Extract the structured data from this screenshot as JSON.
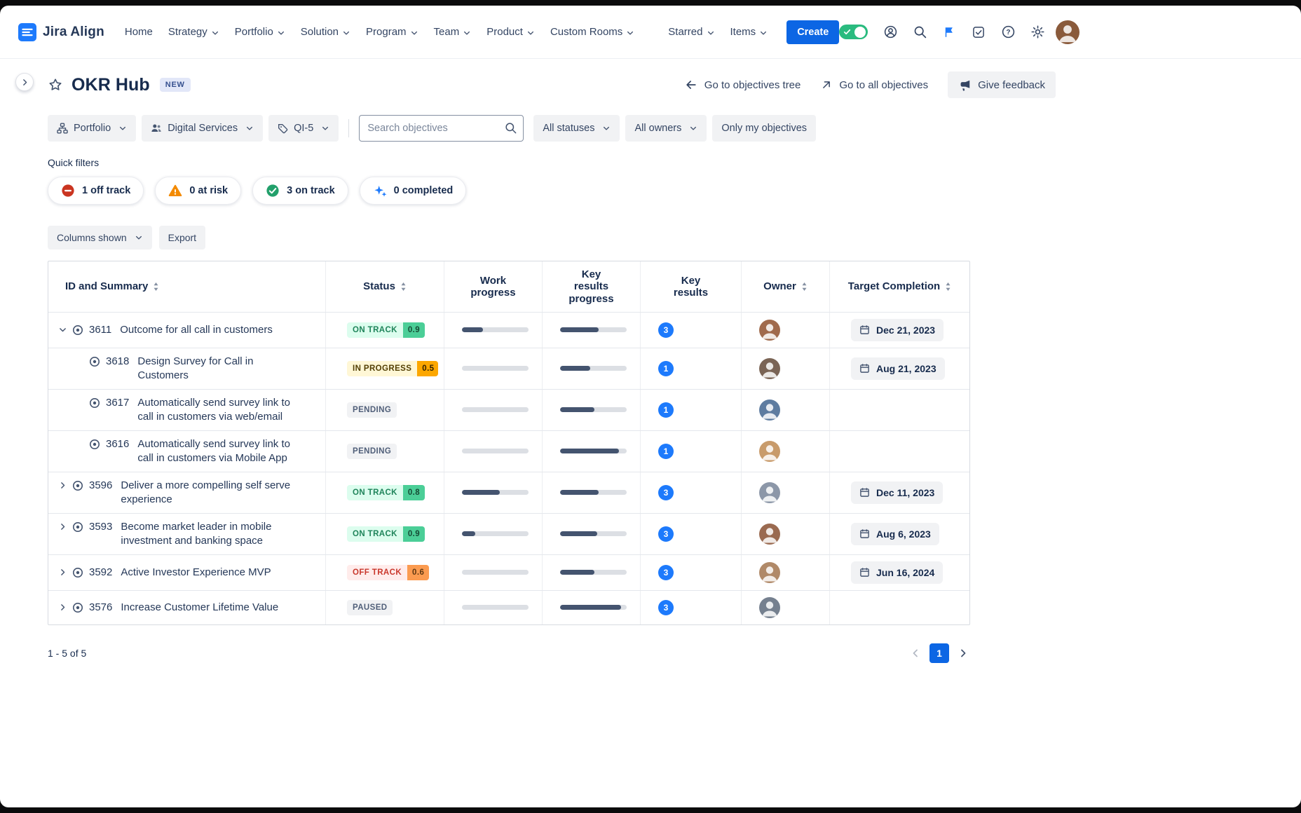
{
  "nav": {
    "brand": "Jira Align",
    "items": [
      {
        "label": "Home",
        "dropdown": false
      },
      {
        "label": "Strategy",
        "dropdown": true
      },
      {
        "label": "Portfolio",
        "dropdown": true
      },
      {
        "label": "Solution",
        "dropdown": true
      },
      {
        "label": "Program",
        "dropdown": true
      },
      {
        "label": "Team",
        "dropdown": true
      },
      {
        "label": "Product",
        "dropdown": true
      },
      {
        "label": "Custom Rooms",
        "dropdown": true
      },
      {
        "label": "Starred",
        "dropdown": true
      },
      {
        "label": "Items",
        "dropdown": true
      }
    ],
    "create_label": "Create"
  },
  "header": {
    "title": "OKR Hub",
    "badge": "NEW",
    "tree_link": "Go to objectives tree",
    "all_objectives_link": "Go to all objectives",
    "feedback_button": "Give feedback"
  },
  "filters": {
    "portfolio": "Portfolio",
    "program": "Digital Services",
    "interval": "QI-5",
    "search_placeholder": "Search objectives",
    "statuses": "All statuses",
    "owners": "All owners",
    "only_mine": "Only my objectives"
  },
  "quick_filters": {
    "label": "Quick filters",
    "items": [
      {
        "label": "1 off track",
        "icon": "off-track-icon",
        "color": "#CA3521"
      },
      {
        "label": "0 at risk",
        "icon": "at-risk-icon",
        "color": "#F38A00"
      },
      {
        "label": "3 on track",
        "icon": "on-track-icon",
        "color": "#22A06B"
      },
      {
        "label": "0 completed",
        "icon": "completed-sparkle-icon",
        "color": "#1D7AFC"
      }
    ]
  },
  "controls": {
    "columns_shown": "Columns shown",
    "export": "Export"
  },
  "table": {
    "columns": [
      {
        "label": "ID and Summary",
        "sortable": true
      },
      {
        "label": "Status",
        "sortable": true
      },
      {
        "label": "Work progress",
        "sortable": false
      },
      {
        "label": "Key results progress",
        "sortable": false
      },
      {
        "label": "Key results",
        "sortable": false
      },
      {
        "label": "Owner",
        "sortable": true
      },
      {
        "label": "Target Completion",
        "sortable": true
      }
    ],
    "status_styles": {
      "on-track": {
        "label_bg": "#DCFDEE",
        "label_color": "#1F845A",
        "chip_bg": "#4BCE97",
        "chip_color": "#164B35"
      },
      "in-progress": {
        "label_bg": "#FFF7D6",
        "label_color": "#533F04",
        "chip_bg": "#FCA700",
        "chip_color": "#332100"
      },
      "pending": {
        "label_bg": "#F1F2F4",
        "label_color": "#505F79",
        "chip_bg": "",
        "chip_color": ""
      },
      "off-track": {
        "label_bg": "#FFECEB",
        "label_color": "#C9372C",
        "chip_bg": "#FB9B50",
        "chip_color": "#5F3811"
      },
      "paused": {
        "label_bg": "#F1F2F4",
        "label_color": "#505F79",
        "chip_bg": "",
        "chip_color": ""
      }
    },
    "rows": [
      {
        "id": "3611",
        "summary": "Outcome for all call in customers",
        "chevron": "down",
        "child": false,
        "status": "ON TRACK",
        "status_type": "on-track",
        "score": "0.9",
        "work_progress": 32,
        "kr_progress": 58,
        "key_results": "3",
        "target_date": "Dec 21, 2023"
      },
      {
        "id": "3618",
        "summary": "Design Survey for Call in Customers",
        "chevron": "none",
        "child": true,
        "status": "IN PROGRESS",
        "status_type": "in-progress",
        "score": "0.5",
        "work_progress": 0,
        "kr_progress": 45,
        "key_results": "1",
        "target_date": "Aug 21, 2023"
      },
      {
        "id": "3617",
        "summary": "Automatically send survey link to call in customers via web/email",
        "chevron": "none",
        "child": true,
        "status": "PENDING",
        "status_type": "pending",
        "score": null,
        "work_progress": 0,
        "kr_progress": 52,
        "key_results": "1",
        "target_date": null
      },
      {
        "id": "3616",
        "summary": "Automatically send survey link to call in customers via Mobile App",
        "chevron": "none",
        "child": true,
        "status": "PENDING",
        "status_type": "pending",
        "score": null,
        "work_progress": 0,
        "kr_progress": 88,
        "key_results": "1",
        "target_date": null
      },
      {
        "id": "3596",
        "summary": "Deliver a more compelling self serve experience",
        "chevron": "right",
        "child": false,
        "status": "ON TRACK",
        "status_type": "on-track",
        "score": "0.8",
        "work_progress": 57,
        "kr_progress": 58,
        "key_results": "3",
        "target_date": "Dec 11, 2023"
      },
      {
        "id": "3593",
        "summary": "Become market leader in mobile investment and banking space",
        "chevron": "right",
        "child": false,
        "status": "ON TRACK",
        "status_type": "on-track",
        "score": "0.9",
        "work_progress": 20,
        "kr_progress": 56,
        "key_results": "3",
        "target_date": "Aug 6, 2023"
      },
      {
        "id": "3592",
        "summary": "Active Investor Experience MVP",
        "chevron": "right",
        "child": false,
        "status": "OFF TRACK",
        "status_type": "off-track",
        "score": "0.6",
        "work_progress": 0,
        "kr_progress": 52,
        "key_results": "3",
        "target_date": "Jun 16, 2024"
      },
      {
        "id": "3576",
        "summary": "Increase Customer Lifetime Value",
        "chevron": "right",
        "child": false,
        "status": "PAUSED",
        "status_type": "paused",
        "score": null,
        "work_progress": 0,
        "kr_progress": 92,
        "key_results": "3",
        "target_date": null
      }
    ]
  },
  "footer": {
    "count": "1 - 5 of 5",
    "current_page": "1"
  }
}
